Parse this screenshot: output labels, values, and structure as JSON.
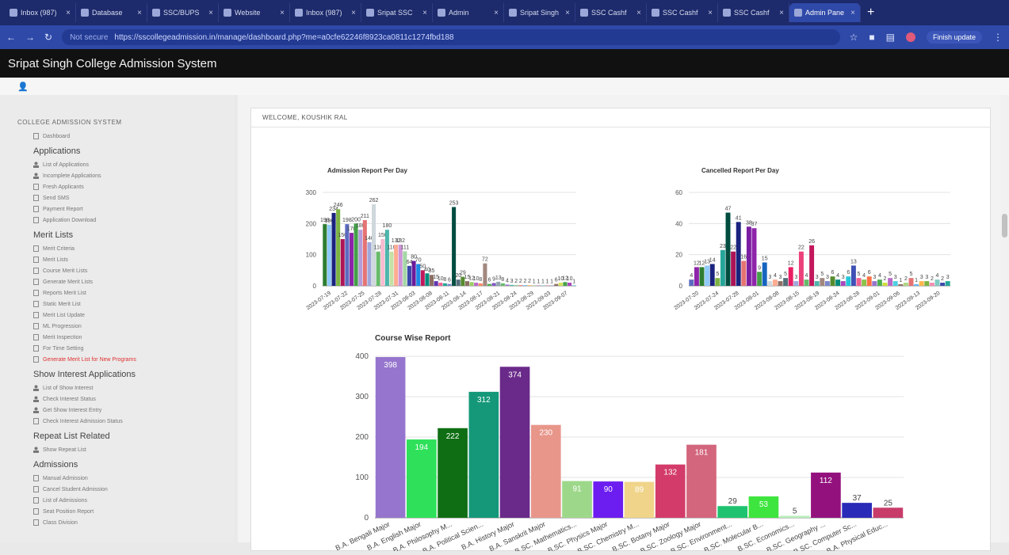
{
  "browser": {
    "tabs": [
      {
        "label": "Inbox (987)"
      },
      {
        "label": "Database"
      },
      {
        "label": "SSC/BUPS"
      },
      {
        "label": "Website"
      },
      {
        "label": "Inbox (987)"
      },
      {
        "label": "Sripat SSC"
      },
      {
        "label": "Admin"
      },
      {
        "label": "Sripat Singh"
      },
      {
        "label": "SSC Cashf"
      },
      {
        "label": "SSC Cashf"
      },
      {
        "label": "SSC Cashf"
      },
      {
        "label": "Admin Pane",
        "active": true
      }
    ],
    "url_security": "Not secure",
    "url": "https://sscollegeadmission.in/manage/dashboard.php?me=a0cfe62246f8923ca0811c1274fbd188",
    "update_label": "Finish update"
  },
  "app": {
    "title": "Sripat Singh College Admission System"
  },
  "sidebar": {
    "title": "COLLEGE ADMISSION SYSTEM",
    "dashboard": "Dashboard",
    "sections": [
      {
        "heading": "Applications",
        "items": [
          {
            "label": "List of Applications",
            "icon": "person"
          },
          {
            "label": "Incomplete Applications",
            "icon": "person"
          },
          {
            "label": "Fresh Applicants",
            "icon": "doc"
          },
          {
            "label": "Send SMS",
            "icon": "doc"
          },
          {
            "label": "Payment Report",
            "icon": "doc"
          },
          {
            "label": "Application Download",
            "icon": "doc"
          }
        ]
      },
      {
        "heading": "Merit Lists",
        "items": [
          {
            "label": "Merit Criteria",
            "icon": "doc"
          },
          {
            "label": "Merit Lists",
            "icon": "doc"
          },
          {
            "label": "Course Merit Lists",
            "icon": "doc"
          },
          {
            "label": "Generate Merit Lists",
            "icon": "doc"
          },
          {
            "label": "Reports Merit List",
            "icon": "doc"
          },
          {
            "label": "Static Merit List",
            "icon": "doc"
          },
          {
            "label": "Merit List Update",
            "icon": "doc"
          },
          {
            "label": "ML Progression",
            "icon": "doc"
          },
          {
            "label": "Merit Inspection",
            "icon": "doc"
          },
          {
            "label": "For Time Setting",
            "icon": "doc"
          },
          {
            "label": "Generate Merit List for New Programs",
            "icon": "doc",
            "alert": true
          }
        ]
      },
      {
        "heading": "Show Interest Applications",
        "items": [
          {
            "label": "List of Show Interest",
            "icon": "person"
          },
          {
            "label": "Check Interest Status",
            "icon": "person"
          },
          {
            "label": "Get Show Interest Entry",
            "icon": "person"
          },
          {
            "label": "Check Interest Admission Status",
            "icon": "doc"
          }
        ]
      },
      {
        "heading": "Repeat List Related",
        "items": [
          {
            "label": "Show Repeat List",
            "icon": "person"
          }
        ]
      },
      {
        "heading": "Admissions",
        "items": [
          {
            "label": "Manual Admission",
            "icon": "doc"
          },
          {
            "label": "Cancel Student Admission",
            "icon": "doc"
          },
          {
            "label": "List of Admissions",
            "icon": "doc"
          },
          {
            "label": "Seat Position Report",
            "icon": "doc"
          },
          {
            "label": "Class Division",
            "icon": "doc"
          }
        ]
      }
    ]
  },
  "main": {
    "welcome": "WELCOME, KOUSHIK RAL"
  },
  "chart_data": [
    {
      "type": "bar",
      "title": "Admission Report Per Day",
      "ylim": [
        0,
        300
      ],
      "yticks": [
        0,
        100,
        200,
        300
      ],
      "xticks": [
        "2023-07-19",
        "2023-07-22",
        "2023-07-25",
        "2023-07-28",
        "2023-07-31",
        "2023-08-03",
        "2023-08-08",
        "2023-08-11",
        "2023-08-14",
        "2023-08-17",
        "2023-08-21",
        "2023-08-24",
        "2023-08-29",
        "2023-09-03",
        "2023-09-07"
      ],
      "values": [
        198,
        196,
        234,
        246,
        150,
        198,
        170,
        200,
        180,
        211,
        140,
        262,
        110,
        150,
        180,
        110,
        132,
        132,
        111,
        64,
        80,
        70,
        50,
        40,
        35,
        15,
        10,
        8,
        6,
        253,
        20,
        29,
        15,
        12,
        10,
        8,
        72,
        6,
        9,
        13,
        8,
        4,
        3,
        2,
        2,
        2,
        2,
        1,
        1,
        1,
        1,
        1,
        6,
        10,
        12,
        10,
        1
      ],
      "colors": [
        "#2e7d32",
        "#90caf9",
        "#1a237e",
        "#7cb342",
        "#ad1457",
        "#5c6bc0",
        "#8e24aa",
        "#43a047",
        "#b39ddb",
        "#e57373",
        "#9fa8da",
        "#cfd8dc",
        "#66bb6a",
        "#f8bbd0",
        "#4db6ac",
        "#c5e1a5",
        "#ffab91",
        "#ce93d8",
        "#a5d6a7",
        "#3949ab",
        "#6a1b9a",
        "#1e88e5",
        "#c2185b",
        "#00897b",
        "#8d6e63",
        "#5e35b1",
        "#f06292",
        "#26a69a",
        "#7986cb",
        "#004d40",
        "#546e7a",
        "#558b2f",
        "#8d6e63",
        "#9ccc65",
        "#ba68c8",
        "#ff8a65",
        "#a1887f",
        "#4caf50",
        "#7e57c2",
        "#90a4ae",
        "#66bb6a",
        "#9575cd",
        "#4db6ac",
        "#81c784",
        "#e57373",
        "#64b5f6",
        "#ffb74d",
        "#aed581",
        "#ba68c8",
        "#4dd0e1",
        "#f06292",
        "#9575cd",
        "#8d6e63",
        "#d4e157",
        "#43a047",
        "#ab47bc",
        "#26c6da"
      ],
      "data_labels": [
        "198",
        "196",
        "234",
        "246",
        "150",
        "198",
        "170",
        "200",
        "180",
        "211",
        "140",
        "262",
        "110",
        "150",
        "180",
        "110",
        "132",
        "132",
        "111",
        "64",
        "80",
        "70",
        "50",
        "40",
        "35",
        "15",
        "10",
        "8",
        "6",
        "253",
        "20",
        "29",
        "15",
        "12",
        "10",
        "8",
        "72",
        "6",
        "9",
        "13",
        "8",
        "4",
        "3",
        "2",
        "2",
        "2",
        "2",
        "1",
        "1",
        "1",
        "1",
        "1",
        "6",
        "10",
        "12",
        "10",
        "1"
      ]
    },
    {
      "type": "bar",
      "title": "Cancelled Report Per Day",
      "ylim": [
        0,
        60
      ],
      "yticks": [
        0,
        20,
        40,
        60
      ],
      "xticks": [
        "2023-07-20",
        "2023-07-24",
        "2023-07-28",
        "2023-08-01",
        "2023-08-08",
        "2023-08-15",
        "2023-08-19",
        "2023-08-24",
        "2023-08-28",
        "2023-09-01",
        "2023-09-06",
        "2023-09-13",
        "2023-09-20"
      ],
      "values": [
        4,
        12,
        12,
        13,
        14,
        5,
        23,
        47,
        22,
        41,
        16,
        38,
        37,
        9,
        15,
        3,
        4,
        3,
        5,
        12,
        3,
        22,
        4,
        26,
        3,
        5,
        3,
        6,
        4,
        3,
        6,
        13,
        5,
        4,
        6,
        3,
        4,
        2,
        5,
        3,
        1,
        2,
        5,
        1,
        3,
        3,
        2,
        4,
        2,
        3
      ],
      "colors": [
        "#5c6bc0",
        "#8e24aa",
        "#2e7d32",
        "#90caf9",
        "#1a237e",
        "#7cb342",
        "#26a69a",
        "#004d40",
        "#ad1457",
        "#1a237e",
        "#e57373",
        "#7b1fa2",
        "#8e24aa",
        "#43a047",
        "#1565c0",
        "#cfd8dc",
        "#ffab91",
        "#8d6e63",
        "#546e7a",
        "#e91e63",
        "#9fa8da",
        "#ec407a",
        "#66bb6a",
        "#c2185b",
        "#4db6ac",
        "#a1887f",
        "#7986cb",
        "#558b2f",
        "#00897b",
        "#ab47bc",
        "#26c6da",
        "#3f51b5",
        "#f06292",
        "#8bc34a",
        "#ff7043",
        "#9575cd",
        "#4caf50",
        "#cddc39",
        "#ba68c8",
        "#4dd0e1",
        "#8d6e63",
        "#aed581",
        "#e57373",
        "#64b5f6",
        "#ffb74d",
        "#7cb342",
        "#f48fb1",
        "#80cbc4",
        "#3949ab",
        "#26a69a"
      ],
      "data_labels": [
        "4",
        "12",
        "12",
        "13",
        "14",
        "5",
        "23",
        "47",
        "22",
        "41",
        "16",
        "38",
        "37",
        "9",
        "15",
        "3",
        "4",
        "3",
        "5",
        "12",
        "3",
        "22",
        "4",
        "26",
        "3",
        "5",
        "3",
        "6",
        "4",
        "3",
        "6",
        "13",
        "5",
        "4",
        "6",
        "3",
        "4",
        "2",
        "5",
        "3",
        "1",
        "2",
        "5",
        "1",
        "3",
        "3",
        "2",
        "4",
        "2",
        "3"
      ]
    },
    {
      "type": "bar",
      "title": "Course Wise Report",
      "ylim": [
        0,
        400
      ],
      "yticks": [
        0,
        100,
        200,
        300,
        400
      ],
      "categories": [
        "B.A. Bengali Major",
        "B.A. English Major",
        "B.A. Philosophy M...",
        "B.A. Political Scien...",
        "B.A. History Major",
        "B.A. Sanskrit Major",
        "B.SC. Mathematics...",
        "B.SC. Physics Major",
        "B.SC. Chemistry M...",
        "B.SC. Botany Major",
        "B.SC. Zoology Major",
        "B.SC. Environment...",
        "B.SC. Molecular B...",
        "B.SC. Economics...",
        "B.SC. Geography ...",
        "B.SC. Computer Sc...",
        "B.A. Physical Educ..."
      ],
      "values": [
        398,
        194,
        222,
        312,
        374,
        230,
        91,
        90,
        89,
        132,
        181,
        29,
        53,
        5,
        112,
        37,
        25
      ],
      "data_labels": [
        "398",
        "194",
        "222",
        "312",
        "374",
        "230",
        "91",
        "90",
        "89",
        "132",
        "181",
        "29",
        "53",
        "5",
        "112",
        "37",
        "25"
      ],
      "colors": [
        "#9575cd",
        "#2ee05a",
        "#0f6e14",
        "#159879",
        "#6a2a8a",
        "#e8968a",
        "#9dd88a",
        "#6c1ef0",
        "#f0d48a",
        "#d33c6a",
        "#d3657d",
        "#1fc36f",
        "#3fe53f",
        "#b9efb9",
        "#93117d",
        "#2a2ab9",
        "#c83c6a"
      ]
    }
  ]
}
